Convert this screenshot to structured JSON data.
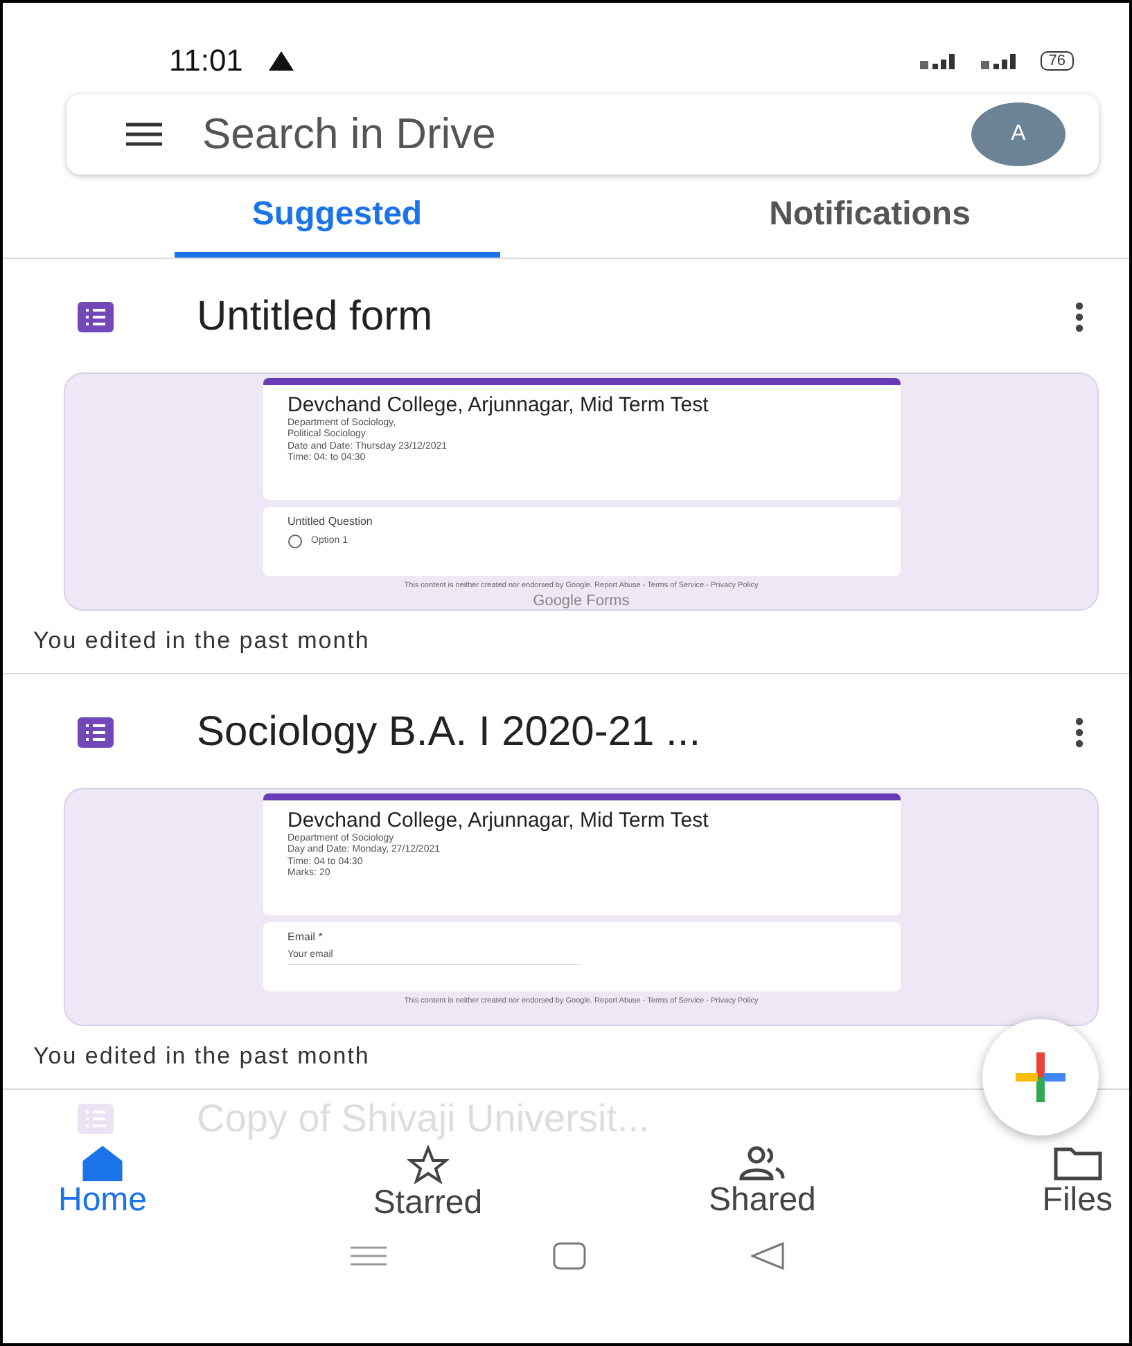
{
  "status_bar": {
    "time": "11:01",
    "battery": "76"
  },
  "search": {
    "placeholder": "Search in Drive",
    "avatar": "A"
  },
  "tabs": [
    {
      "label": "Suggested",
      "selected": true
    },
    {
      "label": "Notifications",
      "selected": false
    }
  ],
  "files": [
    {
      "title": "Untitled form",
      "preview": {
        "heading": "Devchand College, Arjunnagar, Mid Term Test",
        "details": [
          "Department of Sociology,",
          "Political Sociology",
          "Date and Date: Thursday 23/12/2021",
          "Time: 04: to 04:30"
        ],
        "question": "Untitled Question",
        "kind": "radio",
        "answer": "Option 1",
        "answer_selected": false,
        "footer": "This content is neither created nor endorsed by Google. Report Abuse - Terms of Service - Privacy Policy",
        "brand": "Google Forms"
      },
      "activity": "You edited in the past month"
    },
    {
      "title": "Sociology B.A. I 2020-21 ...",
      "preview": {
        "heading": "Devchand College, Arjunnagar, Mid Term Test",
        "details": [
          "Department of Sociology",
          "Day and Date: Monday, 27/12/2021",
          "Time: 04 to 04:30",
          "Marks: 20"
        ],
        "question": "Email *",
        "kind": "text",
        "answer": "Your email",
        "footer": "This content is neither created nor endorsed by Google. Report Abuse - Terms of Service - Privacy Policy"
      },
      "activity": "You edited in the past month"
    },
    {
      "title": "Copy of Shivaji Universit..."
    }
  ],
  "nav": [
    {
      "label": "Home",
      "selected": true
    },
    {
      "label": "Starred",
      "selected": false
    },
    {
      "label": "Shared",
      "selected": false
    },
    {
      "label": "Files",
      "selected": false
    }
  ]
}
